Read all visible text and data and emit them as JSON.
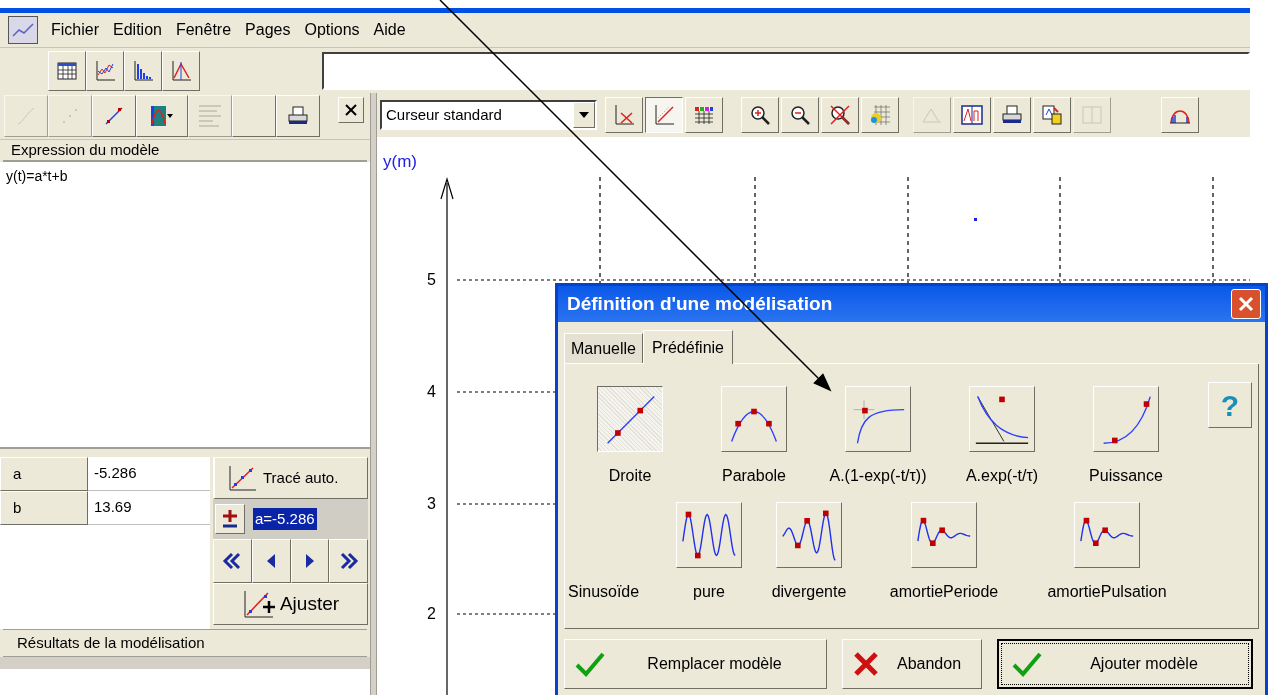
{
  "menu_bar": {
    "items": [
      "Fichier",
      "Edition",
      "Fenêtre",
      "Pages",
      "Options",
      "Aide"
    ]
  },
  "main_toolbar": {
    "tools": [
      {
        "kind": "table"
      },
      {
        "kind": "line-chart"
      },
      {
        "kind": "bar-chart"
      },
      {
        "kind": "peak-chart"
      }
    ]
  },
  "left_toolbar": {
    "tools": [
      {
        "kind": "curve",
        "disabled": true
      },
      {
        "kind": "scatter",
        "disabled": true
      },
      {
        "kind": "fit-line",
        "disabled": false
      },
      {
        "kind": "band-chart",
        "disabled": false
      },
      {
        "kind": "constants",
        "disabled": true
      },
      {
        "kind": "blank",
        "disabled": false
      },
      {
        "kind": "printer",
        "disabled": false
      }
    ]
  },
  "model_panel": {
    "header": "Expression du modèle",
    "expression": "y(t)=a*t+b",
    "parameters": [
      {
        "name": "a",
        "value": "-5.286"
      },
      {
        "name": "b",
        "value": "13.69"
      }
    ],
    "trace_button": "Tracé auto.",
    "parameter_field": {
      "value": "a=-5.286",
      "highlighted": true
    },
    "adjust_button": "Ajuster",
    "results_header": "Résultats de la modélisation"
  },
  "graph_toolbar": {
    "cursor_mode": "Curseur standard",
    "groups": [
      {
        "tools": [
          {
            "kind": "axes-cross",
            "pressed": false,
            "disabled": false
          },
          {
            "kind": "diagonal",
            "pressed": true,
            "disabled": false
          },
          {
            "kind": "color-grid",
            "pressed": false,
            "disabled": false
          }
        ]
      },
      {
        "tools": [
          {
            "kind": "zoom-in",
            "pressed": false,
            "disabled": false
          },
          {
            "kind": "zoom-out",
            "pressed": false,
            "disabled": false
          },
          {
            "kind": "zoom-cancel",
            "pressed": false,
            "disabled": false
          },
          {
            "kind": "paint-grid",
            "pressed": false,
            "disabled": false
          }
        ]
      },
      {
        "tools": [
          {
            "kind": "triangle",
            "pressed": false,
            "disabled": true
          },
          {
            "kind": "split-chart",
            "pressed": false,
            "disabled": false
          },
          {
            "kind": "printer",
            "pressed": false,
            "disabled": false
          },
          {
            "kind": "copy",
            "pressed": false,
            "disabled": false
          },
          {
            "kind": "columns",
            "pressed": false,
            "disabled": true
          }
        ]
      },
      {
        "tools": [
          {
            "kind": "arc-arrows",
            "pressed": false,
            "disabled": false
          }
        ]
      }
    ]
  },
  "graph": {
    "y_axis_title": "y(m)",
    "y_tick_labels": [
      "5",
      "4",
      "3",
      "2"
    ]
  },
  "dialog": {
    "title": "Définition d'une modélisation",
    "tabs": [
      {
        "label": "Manuelle",
        "selected": false
      },
      {
        "label": "Prédéfinie",
        "selected": true
      }
    ],
    "models": [
      {
        "label": "Droite",
        "kind": "line",
        "selected": true
      },
      {
        "label": "Parabole",
        "kind": "parabola",
        "selected": false
      },
      {
        "label": "A.(1-exp(-t/τ))",
        "kind": "exp-rise",
        "selected": false
      },
      {
        "label": "A.exp(-t/τ)",
        "kind": "exp-decay",
        "selected": false
      },
      {
        "label": "Puissance",
        "kind": "power",
        "selected": false
      }
    ],
    "help_button": "?",
    "sinusoid_group_label": "Sinusoïde",
    "sinusoids": [
      {
        "label": "pure",
        "kind": "pure",
        "selected": false
      },
      {
        "label": "divergente",
        "kind": "divergent",
        "selected": false
      },
      {
        "label": "amortiePeriode",
        "kind": "damped",
        "selected": false
      },
      {
        "label": "amortiePulsation",
        "kind": "damped",
        "selected": false
      }
    ],
    "buttons": [
      {
        "label": "Remplacer modèle",
        "kind": "check",
        "default": false
      },
      {
        "label": "Abandon",
        "kind": "cross",
        "default": false
      },
      {
        "label": "Ajouter modèle",
        "kind": "check",
        "default": true
      }
    ]
  }
}
